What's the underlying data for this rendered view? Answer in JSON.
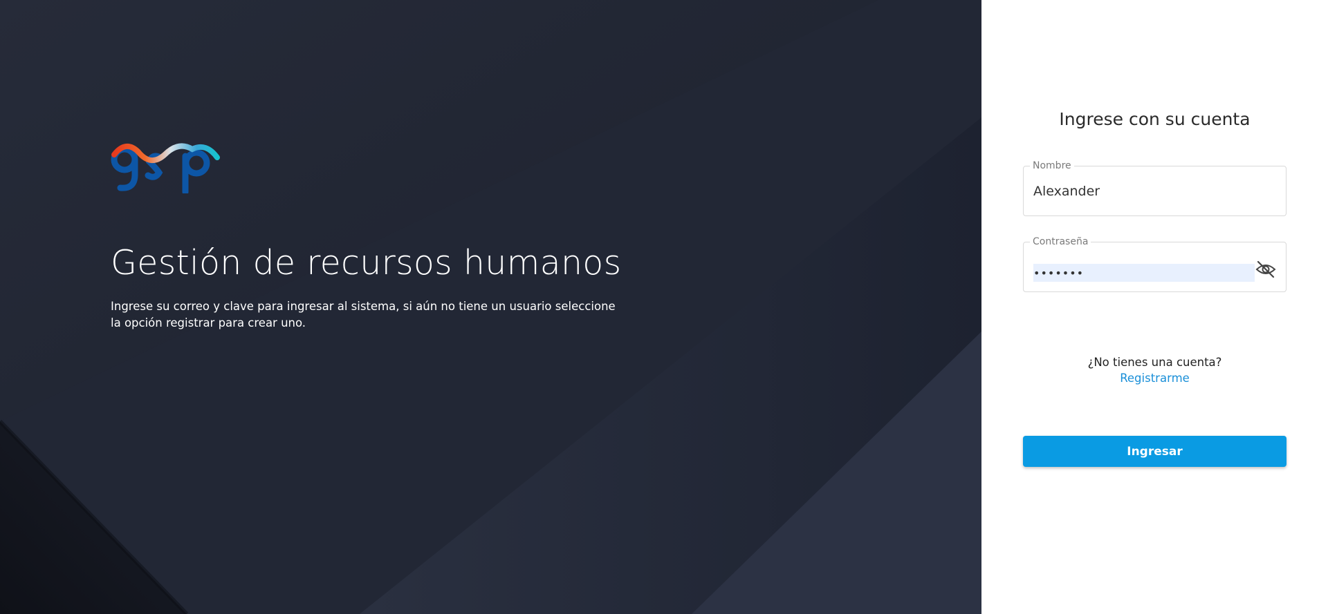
{
  "hero": {
    "title": "Gestión de recursos humanos",
    "description": "Ingrese su correo y clave para ingresar al sistema, si aún no tiene un usuario seleccione la opción registrar para crear uno.",
    "logo_icon": "gsp-logo",
    "background_color": "#1f2330"
  },
  "login": {
    "title": "Ingrese con su cuenta",
    "name_field": {
      "label": "Nombre",
      "value": "Alexander"
    },
    "password_field": {
      "label": "Contraseña",
      "value": "•••••••",
      "toggle_icon": "eye-off-icon"
    },
    "signup_question": "¿No tienes una cuenta?",
    "signup_link": "Registrarme",
    "submit_label": "Ingresar",
    "accent_color": "#0a9be3",
    "link_color": "#1a8fd8"
  }
}
